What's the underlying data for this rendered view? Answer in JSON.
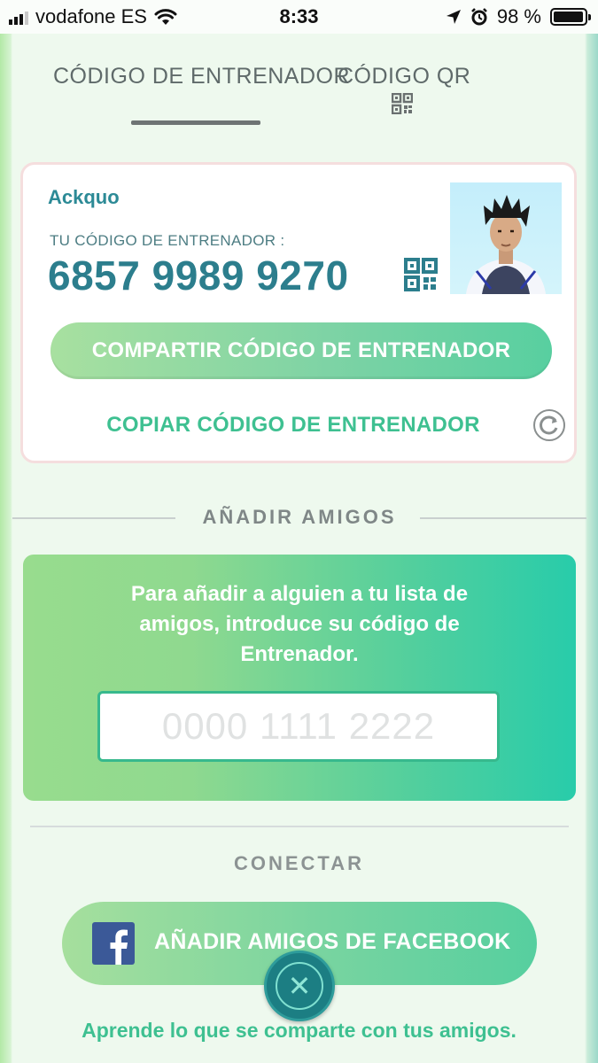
{
  "status_bar": {
    "carrier": "vodafone ES",
    "time": "8:33",
    "battery_text": "98 %",
    "battery_level": 0.98,
    "icons": [
      "signal-icon",
      "wifi-icon",
      "location-arrow-icon",
      "alarm-icon",
      "battery-icon"
    ]
  },
  "tabs": {
    "trainer_code": "CÓDIGO DE ENTRENADOR",
    "qr_code": "CÓDIGO QR",
    "active": "trainer_code"
  },
  "profile": {
    "username": "Ackquo",
    "code_label": "TU CÓDIGO DE ENTRENADOR :",
    "code_value": "6857 9989 9270",
    "share_label": "COMPARTIR CÓDIGO DE ENTRENADOR",
    "copy_label": "COPIAR CÓDIGO DE ENTRENADOR"
  },
  "add_friends": {
    "title": "AÑADIR AMIGOS",
    "instructions": "Para añadir a alguien a tu lista de amigos, introduce su código de Entrenador.",
    "input_placeholder": "0000 1111 2222",
    "input_value": ""
  },
  "connect": {
    "title": "CONECTAR",
    "facebook_label": "AÑADIR AMIGOS DE FACEBOOK",
    "learn_more": "Aprende lo que se comparte con tus amigos."
  },
  "colors": {
    "accent_teal": "#2c7e8d",
    "accent_green": "#3ec091",
    "facebook_blue": "#3b5998"
  }
}
